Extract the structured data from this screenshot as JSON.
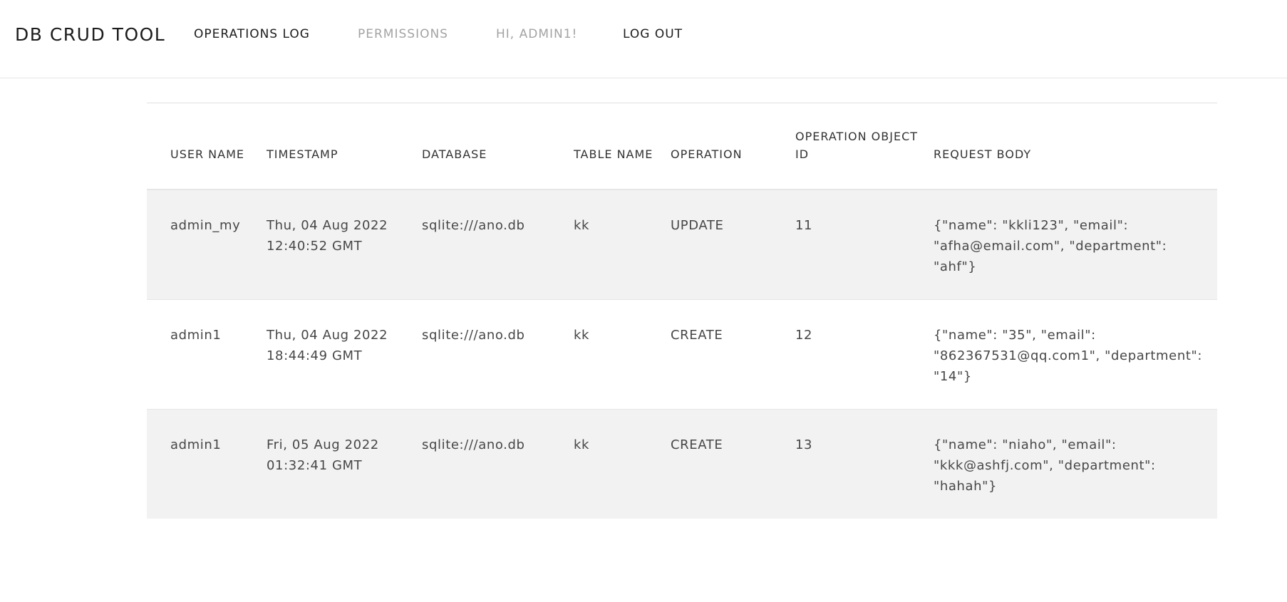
{
  "navbar": {
    "brand": "DB CRUD TOOL",
    "links": [
      {
        "label": "OPERATIONS LOG"
      },
      {
        "label": "PERMISSIONS"
      },
      {
        "label": "HI, ADMIN1!"
      },
      {
        "label": "LOG OUT"
      }
    ]
  },
  "table": {
    "headers": {
      "user_name": "USER NAME",
      "timestamp": "TIMESTAMP",
      "database": "DATABASE",
      "table_name": "TABLE NAME",
      "operation": "OPERATION",
      "object_id": "OPERATION OBJECT ID",
      "request_body": "REQUEST BODY"
    },
    "rows": [
      {
        "user_name": "admin_my",
        "timestamp": "Thu, 04 Aug 2022 12:40:52 GMT",
        "database": "sqlite:///ano.db",
        "table_name": "kk",
        "operation": "UPDATE",
        "object_id": "11",
        "request_body": "{\"name\": \"kkli123\", \"email\": \"afha@email.com\", \"department\": \"ahf\"}"
      },
      {
        "user_name": "admin1",
        "timestamp": "Thu, 04 Aug 2022 18:44:49 GMT",
        "database": "sqlite:///ano.db",
        "table_name": "kk",
        "operation": "CREATE",
        "object_id": "12",
        "request_body": "{\"name\": \"35\", \"email\": \"862367531@qq.com1\", \"department\": \"14\"}"
      },
      {
        "user_name": "admin1",
        "timestamp": "Fri, 05 Aug 2022 01:32:41 GMT",
        "database": "sqlite:///ano.db",
        "table_name": "kk",
        "operation": "CREATE",
        "object_id": "13",
        "request_body": "{\"name\": \"niaho\", \"email\": \"kkk@ashfj.com\", \"department\": \"hahah\"}"
      }
    ]
  }
}
